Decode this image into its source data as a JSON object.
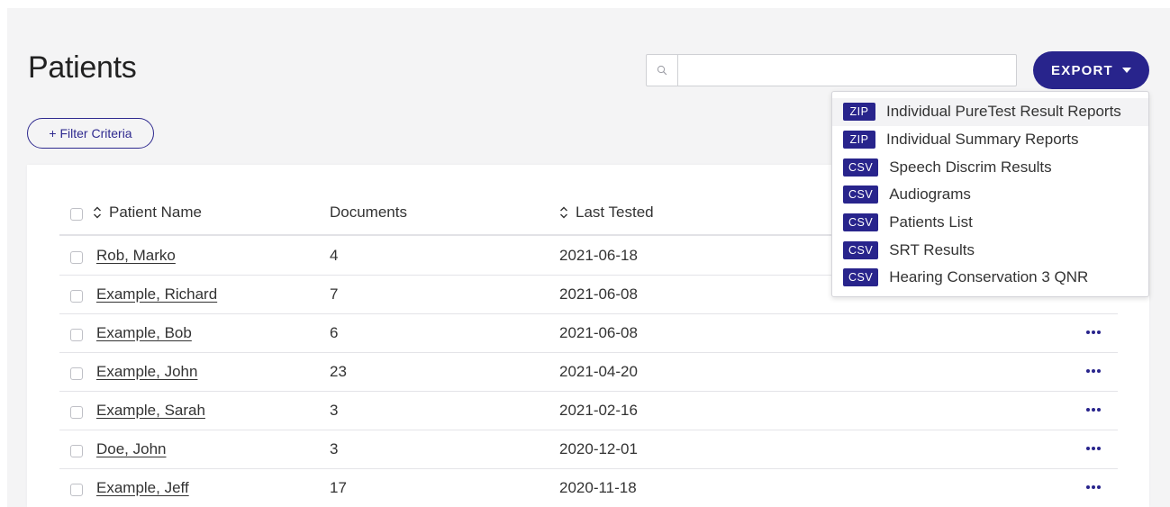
{
  "header": {
    "title": "Patients",
    "search_placeholder": "",
    "export_label": "EXPORT",
    "filter_label": "+ Filter Criteria"
  },
  "table": {
    "columns": {
      "name": "Patient Name",
      "documents": "Documents",
      "last_tested": "Last Tested"
    },
    "rows": [
      {
        "name": "Rob, Marko",
        "documents": "4",
        "last_tested": "2021-06-18"
      },
      {
        "name": "Example, Richard",
        "documents": "7",
        "last_tested": "2021-06-08"
      },
      {
        "name": "Example, Bob",
        "documents": "6",
        "last_tested": "2021-06-08"
      },
      {
        "name": "Example, John",
        "documents": "23",
        "last_tested": "2021-04-20"
      },
      {
        "name": "Example, Sarah",
        "documents": "3",
        "last_tested": "2021-02-16"
      },
      {
        "name": "Doe, John",
        "documents": "3",
        "last_tested": "2020-12-01"
      },
      {
        "name": "Example, Jeff",
        "documents": "17",
        "last_tested": "2020-11-18"
      }
    ]
  },
  "export_menu": [
    {
      "badge": "ZIP",
      "label": "Individual PureTest Result Reports"
    },
    {
      "badge": "ZIP",
      "label": "Individual Summary Reports"
    },
    {
      "badge": "CSV",
      "label": "Speech Discrim Results"
    },
    {
      "badge": "CSV",
      "label": "Audiograms"
    },
    {
      "badge": "CSV",
      "label": "Patients List"
    },
    {
      "badge": "CSV",
      "label": "SRT Results"
    },
    {
      "badge": "CSV",
      "label": "Hearing Conservation 3 QNR"
    }
  ],
  "icons": {
    "search": "search-icon",
    "sort": "sort-icon",
    "caret": "caret-down-icon",
    "more": "more-options-icon"
  },
  "colors": {
    "accent": "#28248c",
    "page_bg": "#f4f4f5",
    "card_bg": "#ffffff"
  }
}
